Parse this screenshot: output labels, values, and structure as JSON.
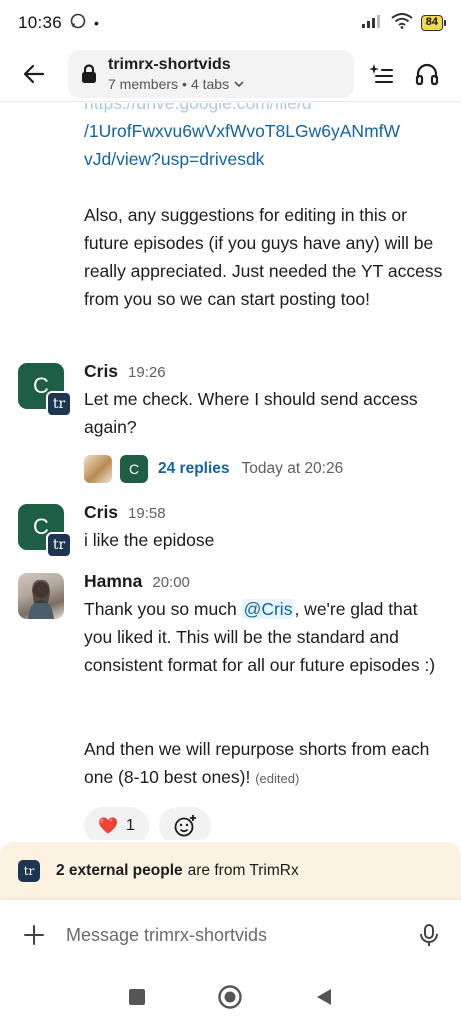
{
  "status_bar": {
    "time": "10:36",
    "battery": "84"
  },
  "header": {
    "channel_name": "trimrx-shortvids",
    "members": "7 members",
    "tabs": "4 tabs"
  },
  "continued_message": {
    "link_line1": "/1UrofFwxvu6wVxfWvoT8LGw6yANmfW",
    "link_line2": "vJd/view?usp=drivesdk",
    "paragraph": "Also, any suggestions for editing in this or future episodes (if you guys have any) will be really appreciated. Just needed the YT access from you so we can start posting too!"
  },
  "messages": [
    {
      "author": "Cris",
      "time": "19:26",
      "avatar_letter": "C",
      "org_badge": "tr",
      "text": "Let me check. Where I should send access again?",
      "thread": {
        "mini_letter": "C",
        "replies": "24 replies",
        "last_reply": "Today at 20:26"
      }
    },
    {
      "author": "Cris",
      "time": "19:58",
      "avatar_letter": "C",
      "org_badge": "tr",
      "text": "i like the epidose"
    },
    {
      "author": "Hamna",
      "time": "20:00",
      "text_before": "Thank you so much ",
      "mention": "@Cris",
      "text_after": ", we're glad that you liked it. This will be the standard and consistent format for all our future episodes :)",
      "text_second": "And then we will repurpose shorts from each one (8-10 best ones)! ",
      "edited": "(edited)",
      "reaction_emoji": "❤️",
      "reaction_count": "1"
    }
  ],
  "external_banner": {
    "badge": "tr",
    "bold": "2 external people",
    "rest": "are from TrimRx"
  },
  "composer": {
    "placeholder": "Message trimrx-shortvids"
  },
  "colors": {
    "accent_link": "#1264a3",
    "avatar_green": "#1d5e44",
    "banner_bg": "#fcf2e2"
  }
}
